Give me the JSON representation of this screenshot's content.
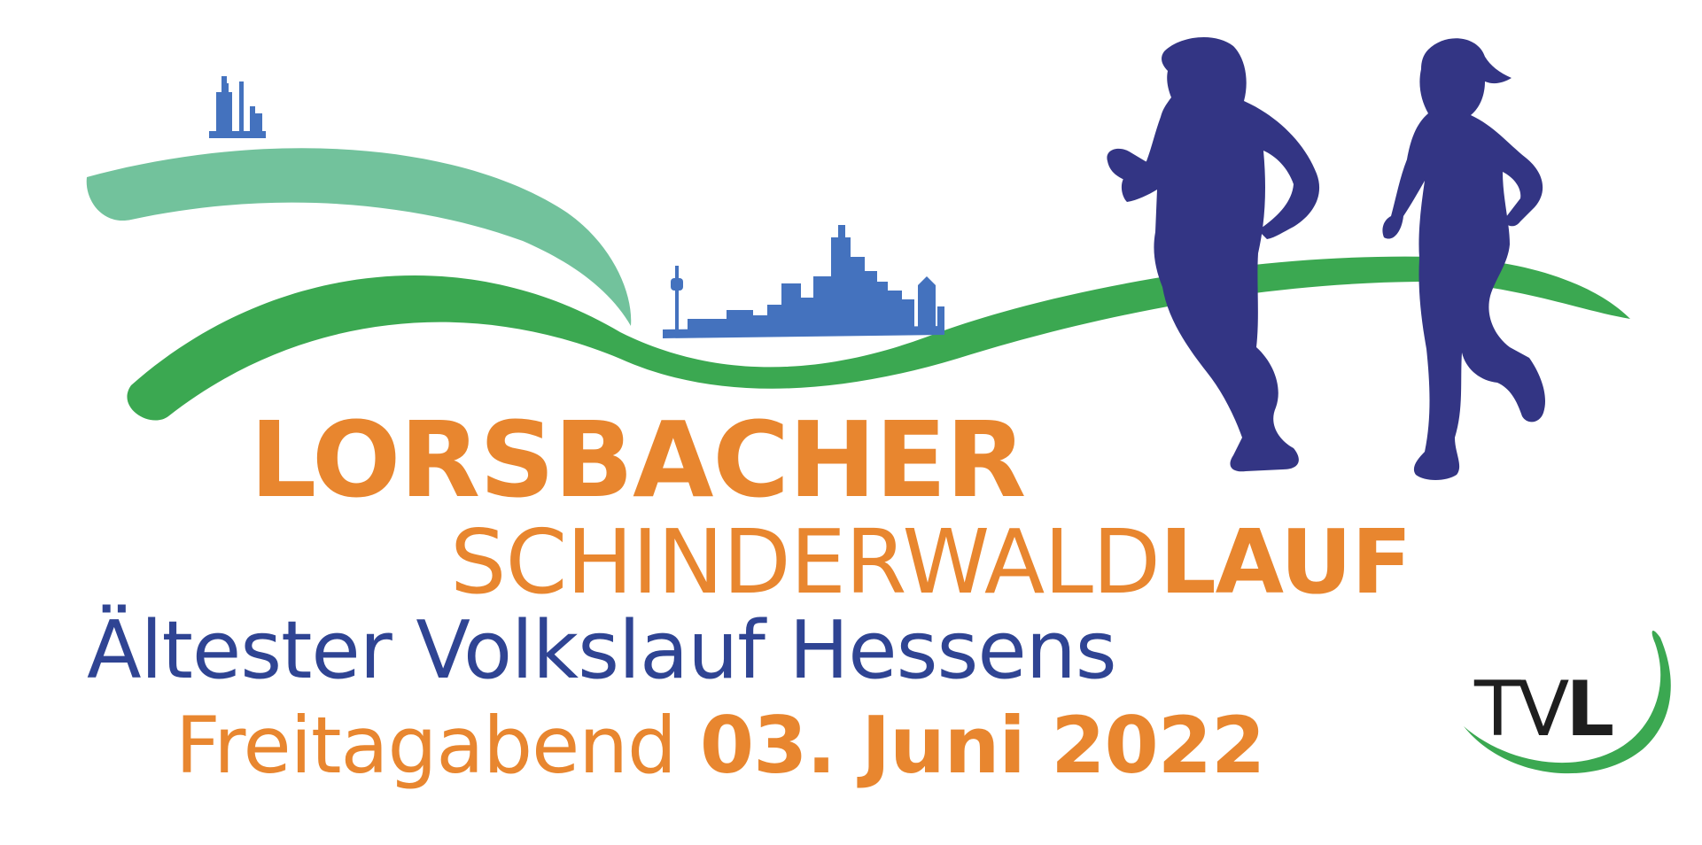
{
  "event": {
    "title_line1": "LORSBACHER",
    "title_line2_light": "SCHINDERWALD",
    "title_line2_bold": "LAUF",
    "subtitle": "Ältester Volkslauf Hessens",
    "date_prefix": "Freitagabend",
    "date": "03. Juni 2022"
  },
  "club": {
    "abbr_light": "TV",
    "abbr_bold": "L"
  },
  "icons": [
    "hill-wave",
    "ground-wave",
    "tower-skyline-icon",
    "frankfurt-skyline-icon",
    "male-runner-icon",
    "female-runner-icon",
    "club-swoosh"
  ],
  "colors": {
    "orange": "#E8862F",
    "navy": "#2F4493",
    "runner_navy": "#333584",
    "light_green": "#72C29C",
    "green": "#3BA851",
    "skyline_blue": "#4472BE",
    "logo_dark": "#1E1E1E"
  }
}
